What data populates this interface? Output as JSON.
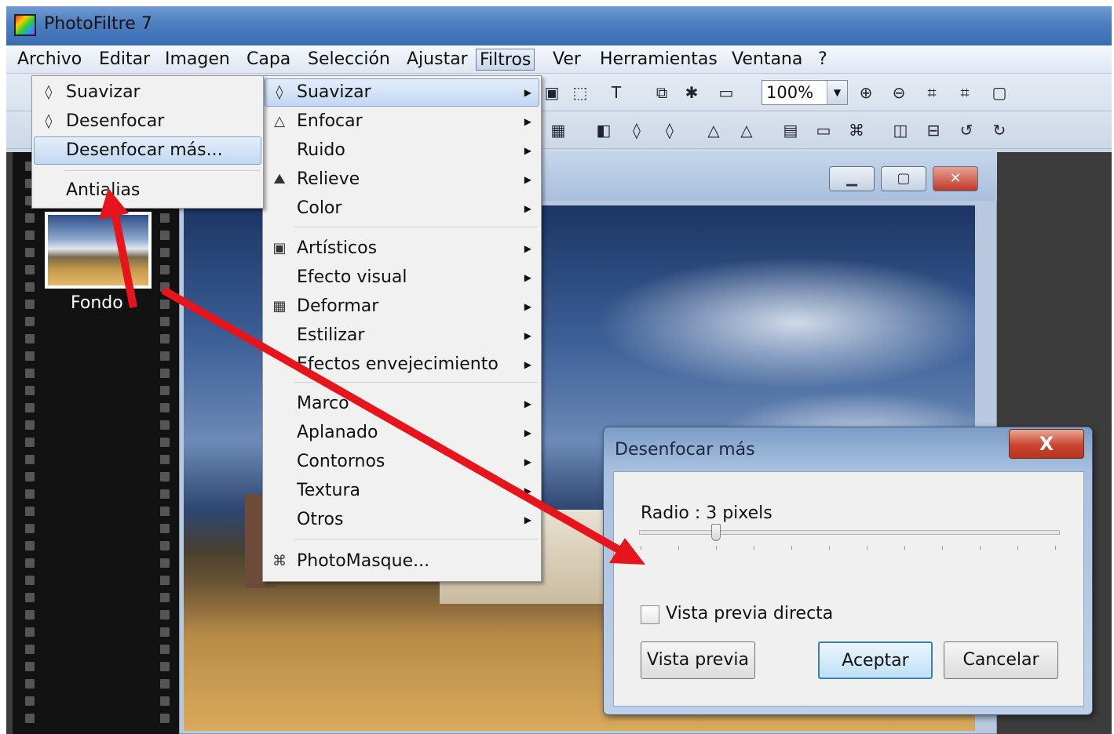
{
  "window": {
    "title": "PhotoFiltre 7",
    "logo_icon": "photofiltre-logo-icon"
  },
  "menubar": {
    "items": [
      "Archivo",
      "Editar",
      "Imagen",
      "Capa",
      "Selección",
      "Ajustar",
      "Filtros",
      "Ver",
      "Herramientas",
      "Ventana",
      "?"
    ],
    "active": "Filtros"
  },
  "toolbar": {
    "zoom_value": "100%"
  },
  "layers": {
    "layer_name": "Fondo"
  },
  "filters_menu": {
    "items": [
      {
        "label": "Suavizar",
        "icon": "drop-icon",
        "submenu": true,
        "highlighted": true
      },
      {
        "label": "Enfocar",
        "icon": "sharpen-icon",
        "submenu": true
      },
      {
        "label": "Ruido",
        "submenu": true
      },
      {
        "label": "Relieve",
        "icon": "relief-icon",
        "submenu": true
      },
      {
        "label": "Color",
        "submenu": true
      },
      {
        "label": "Artísticos",
        "icon": "portrait-icon",
        "submenu": true
      },
      {
        "label": "Efecto visual",
        "submenu": true
      },
      {
        "label": "Deformar",
        "icon": "grid-icon",
        "submenu": true
      },
      {
        "label": "Estilizar",
        "submenu": true
      },
      {
        "label": "Efectos envejecimiento",
        "submenu": true
      },
      {
        "label": "Marco",
        "submenu": true
      },
      {
        "label": "Aplanado",
        "submenu": true
      },
      {
        "label": "Contornos",
        "submenu": true
      },
      {
        "label": "Textura",
        "submenu": true
      },
      {
        "label": "Otros",
        "submenu": true
      },
      {
        "label": "PhotoMasque...",
        "icon": "photomasque-icon"
      }
    ]
  },
  "suavizar_submenu": {
    "items": [
      {
        "label": "Suavizar",
        "icon": "drop-icon"
      },
      {
        "label": "Desenfocar",
        "icon": "blur-drop-icon"
      },
      {
        "label": "Desenfocar más...",
        "highlighted": true
      },
      {
        "label": "Antialias"
      }
    ]
  },
  "dialog": {
    "title": "Desenfocar más",
    "close_label": "X",
    "radius_label": "Radio : 3 pixels",
    "radius_value": 3,
    "preview_checkbox_label": "Vista previa directa",
    "preview_checked": false,
    "buttons": {
      "preview": "Vista previa",
      "ok": "Aceptar",
      "cancel": "Cancelar"
    }
  },
  "annotation": {
    "arrow_color": "#e8141b"
  },
  "colors": {
    "menu_highlight": "#c3d8f2",
    "workspace": "#3c3c3c",
    "filmstrip": "#121212"
  }
}
